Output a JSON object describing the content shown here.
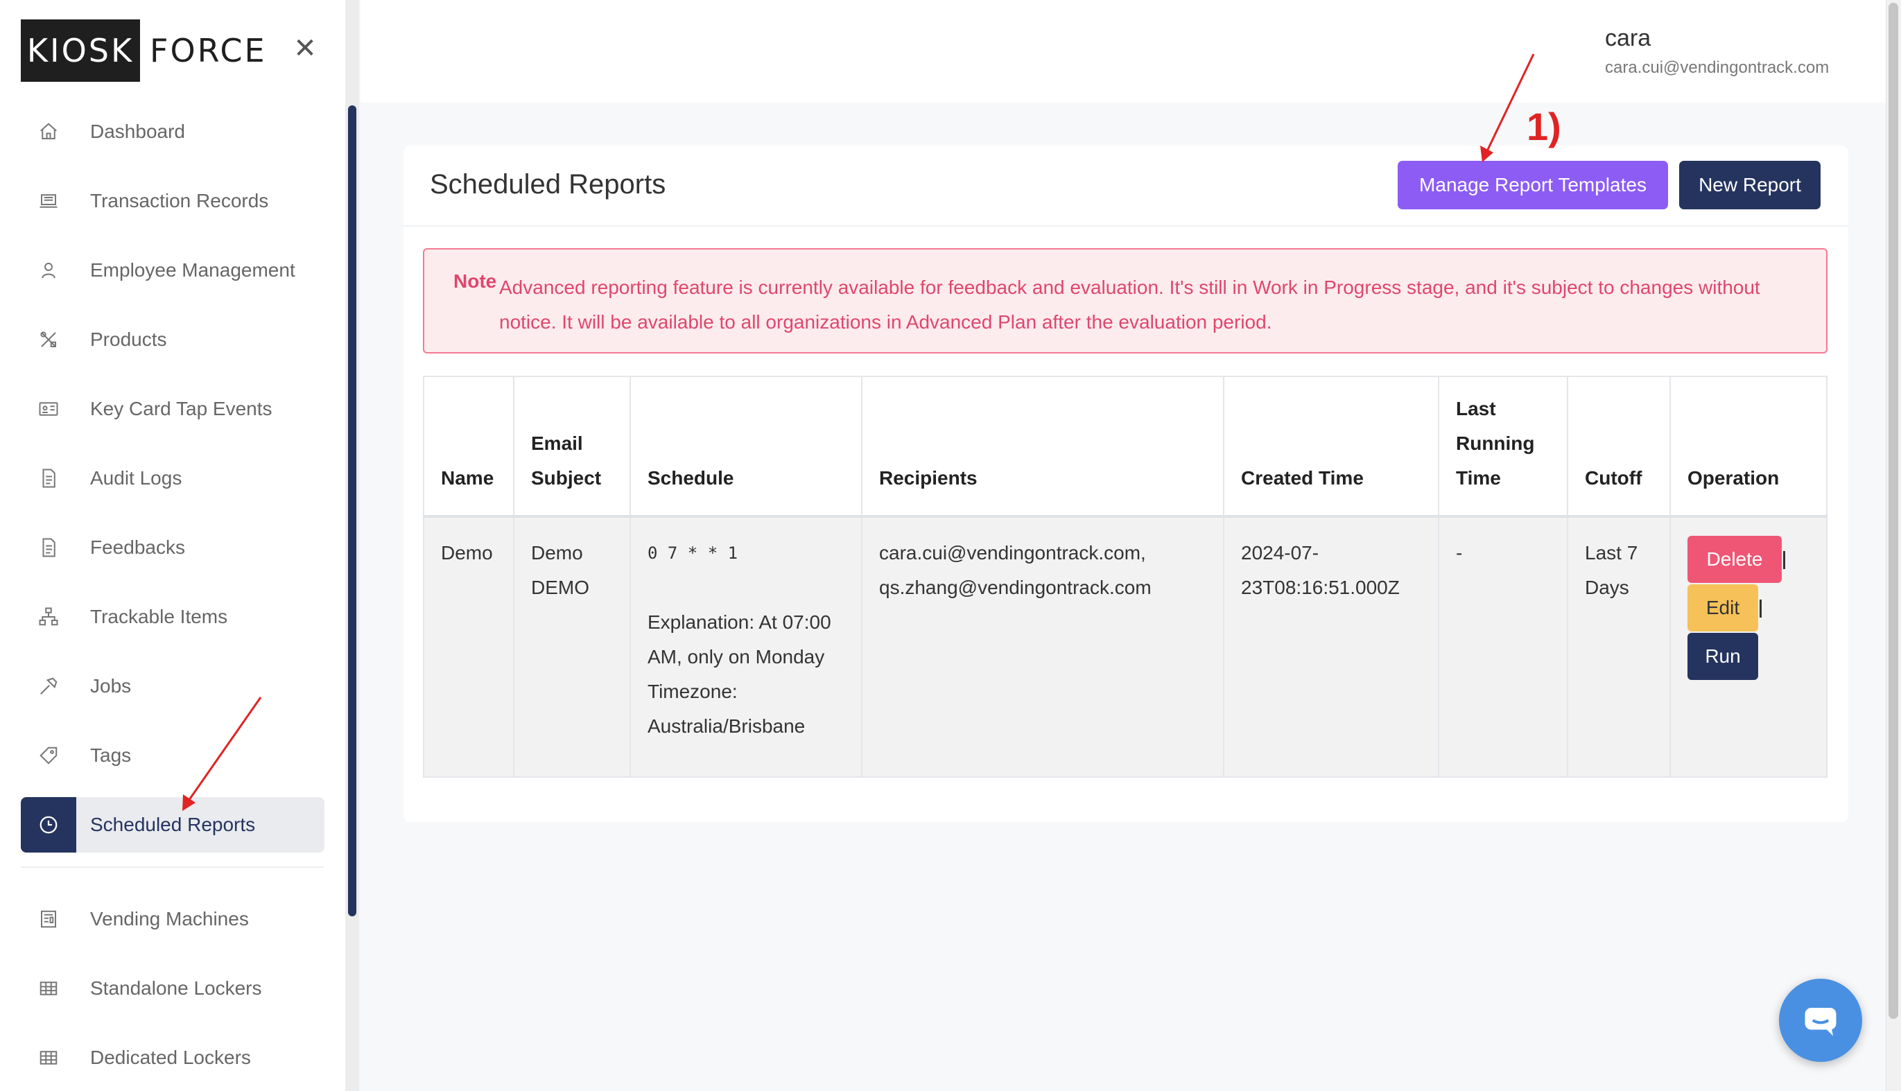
{
  "brand": {
    "logo_left": "KIOSK",
    "logo_right": "FORCE",
    "close_glyph": "✕"
  },
  "sidebar": {
    "items": [
      {
        "label": "Dashboard",
        "icon": "home-icon"
      },
      {
        "label": "Transaction Records",
        "icon": "laptop-icon"
      },
      {
        "label": "Employee Management",
        "icon": "user-icon"
      },
      {
        "label": "Products",
        "icon": "tools-icon"
      },
      {
        "label": "Key Card Tap Events",
        "icon": "id-card-icon"
      },
      {
        "label": "Audit Logs",
        "icon": "document-icon"
      },
      {
        "label": "Feedbacks",
        "icon": "document-icon"
      },
      {
        "label": "Trackable Items",
        "icon": "sitemap-icon"
      },
      {
        "label": "Jobs",
        "icon": "hammer-icon"
      },
      {
        "label": "Tags",
        "icon": "tag-icon"
      },
      {
        "label": "Scheduled Reports",
        "icon": "clock-icon",
        "active": true
      }
    ],
    "items_after_divider": [
      {
        "label": "Vending Machines",
        "icon": "machine-icon"
      },
      {
        "label": "Standalone Lockers",
        "icon": "grid-icon"
      },
      {
        "label": "Dedicated Lockers",
        "icon": "grid-icon"
      }
    ]
  },
  "header": {
    "user_name": "cara",
    "user_email": "cara.cui@vendingontrack.com"
  },
  "page": {
    "title": "Scheduled Reports",
    "manage_templates_label": "Manage Report Templates",
    "new_report_label": "New Report"
  },
  "note": {
    "label": "Note",
    "text": "Advanced reporting feature is currently available for feedback and evaluation. It's still in Work in Progress stage, and it's subject to changes without notice. It will be available to all organizations in Advanced Plan after the evaluation period."
  },
  "table": {
    "headers": [
      "Name",
      "Email Subject",
      "Schedule",
      "Recipients",
      "Created Time",
      "Last Running Time",
      "Cutoff",
      "Operation"
    ],
    "rows": [
      {
        "name": "Demo",
        "email_subject": "Demo DEMO",
        "schedule_cron": "0 7 * * 1",
        "schedule_explanation": "Explanation: At 07:00 AM, only on Monday",
        "schedule_timezone": "Timezone: Australia/Brisbane",
        "recipients": "cara.cui@vendingontrack.com, qs.zhang@vendingontrack.com",
        "created_time": "2024-07-23T08:16:51.000Z",
        "last_running_time": "-",
        "cutoff": "Last 7 Days",
        "operations": {
          "delete": "Delete",
          "edit": "Edit",
          "run": "Run"
        }
      }
    ]
  },
  "annotation": {
    "label": "1)",
    "color": "#e02424"
  },
  "colors": {
    "primary": "#25345f",
    "templates_button": "#8c5cf5",
    "delete_button": "#ef5675",
    "edit_button": "#f5c158",
    "note_text": "#e0466c",
    "chat_button": "#4a90e2"
  },
  "chat": {
    "icon": "chat-bubble-icon"
  }
}
